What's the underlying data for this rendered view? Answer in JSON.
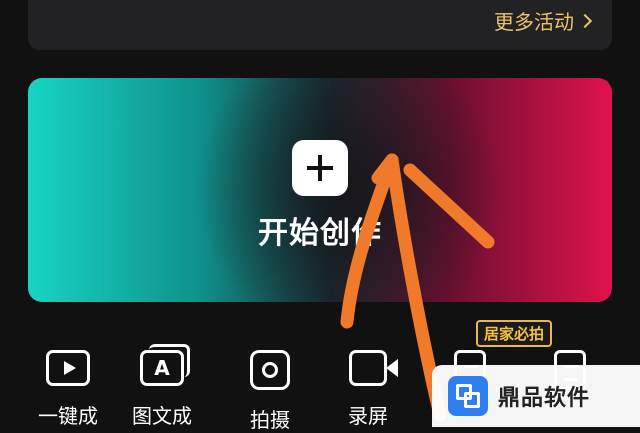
{
  "activity_card": {
    "more_label": "更多活动"
  },
  "create_card": {
    "label": "开始创作"
  },
  "badge": "居家必拍",
  "tools": [
    {
      "label": "一键成"
    },
    {
      "label": "图文成"
    },
    {
      "label": "拍摄"
    },
    {
      "label": "录屏"
    }
  ],
  "watermark": {
    "text": "鼎品软件"
  },
  "colors": {
    "background": "#111112",
    "accent_gold": "#e9c46a",
    "gradient_left": "#17d4c4",
    "gradient_right": "#e0124c",
    "annotation": "#f07a2a"
  }
}
